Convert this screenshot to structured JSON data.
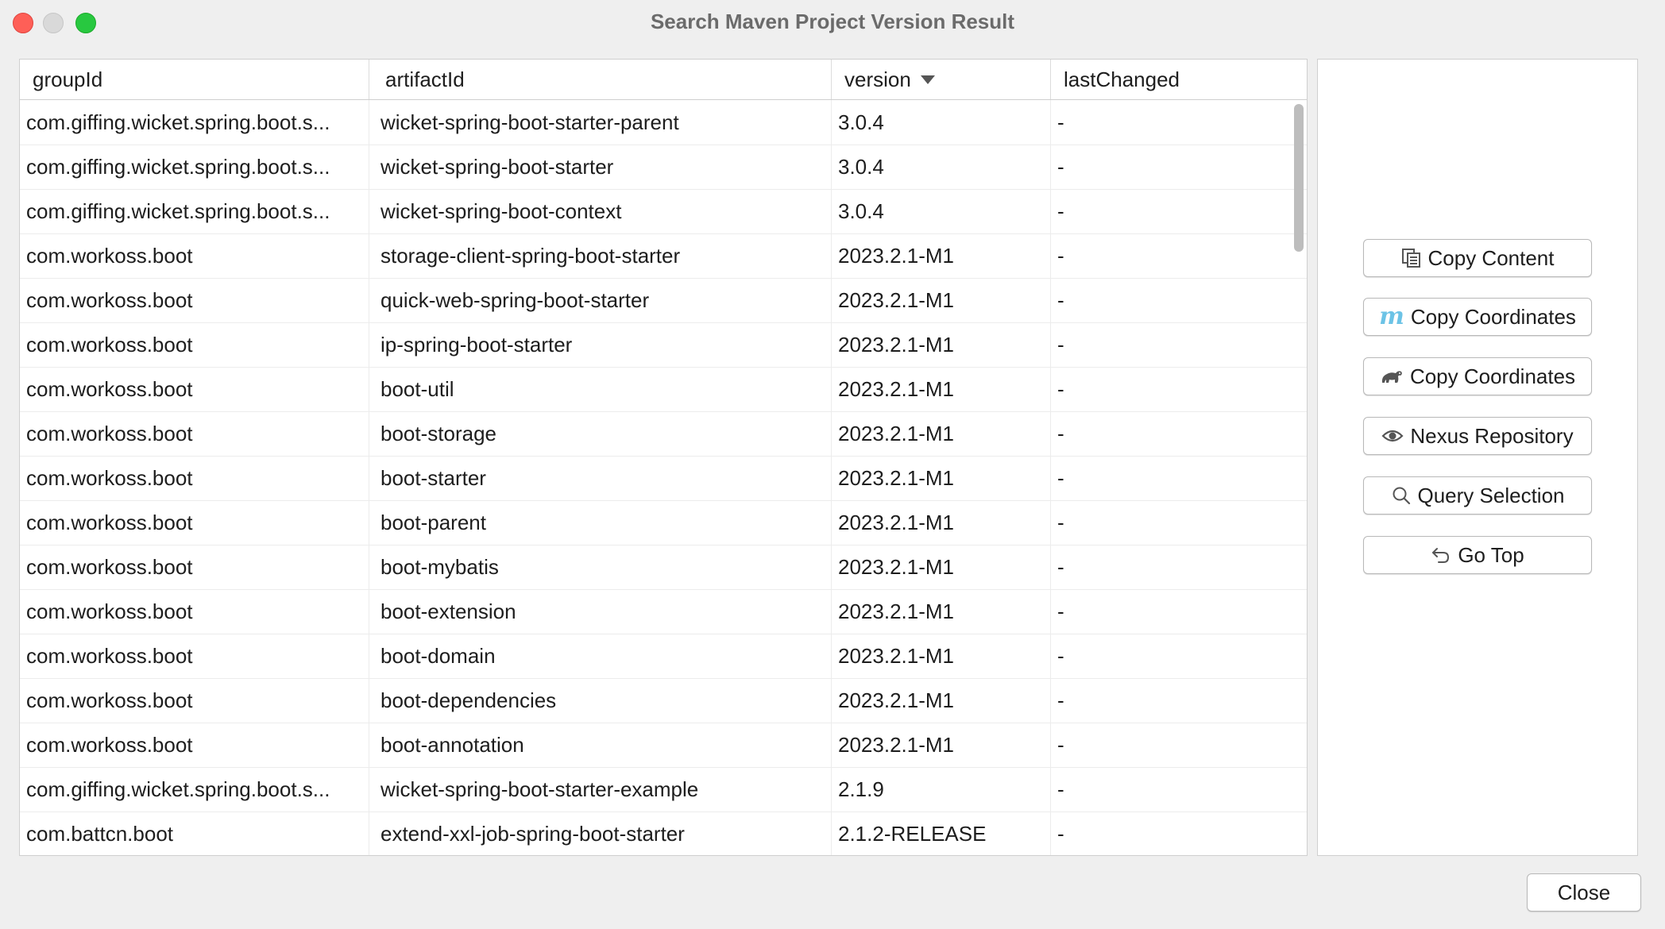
{
  "window": {
    "title": "Search Maven Project Version Result"
  },
  "table": {
    "columns": [
      "groupId",
      "artifactId",
      "version",
      "lastChanged"
    ],
    "rows": [
      [
        "com.giffing.wicket.spring.boot.s...",
        "wicket-spring-boot-starter-parent",
        "3.0.4",
        "-"
      ],
      [
        "com.giffing.wicket.spring.boot.s...",
        "wicket-spring-boot-starter",
        "3.0.4",
        "-"
      ],
      [
        "com.giffing.wicket.spring.boot.s...",
        "wicket-spring-boot-context",
        "3.0.4",
        "-"
      ],
      [
        "com.workoss.boot",
        "storage-client-spring-boot-starter",
        "2023.2.1-M1",
        "-"
      ],
      [
        "com.workoss.boot",
        "quick-web-spring-boot-starter",
        "2023.2.1-M1",
        "-"
      ],
      [
        "com.workoss.boot",
        "ip-spring-boot-starter",
        "2023.2.1-M1",
        "-"
      ],
      [
        "com.workoss.boot",
        "boot-util",
        "2023.2.1-M1",
        "-"
      ],
      [
        "com.workoss.boot",
        "boot-storage",
        "2023.2.1-M1",
        "-"
      ],
      [
        "com.workoss.boot",
        "boot-starter",
        "2023.2.1-M1",
        "-"
      ],
      [
        "com.workoss.boot",
        "boot-parent",
        "2023.2.1-M1",
        "-"
      ],
      [
        "com.workoss.boot",
        "boot-mybatis",
        "2023.2.1-M1",
        "-"
      ],
      [
        "com.workoss.boot",
        "boot-extension",
        "2023.2.1-M1",
        "-"
      ],
      [
        "com.workoss.boot",
        "boot-domain",
        "2023.2.1-M1",
        "-"
      ],
      [
        "com.workoss.boot",
        "boot-dependencies",
        "2023.2.1-M1",
        "-"
      ],
      [
        "com.workoss.boot",
        "boot-annotation",
        "2023.2.1-M1",
        "-"
      ],
      [
        "com.giffing.wicket.spring.boot.s...",
        "wicket-spring-boot-starter-example",
        "2.1.9",
        "-"
      ],
      [
        "com.battcn.boot",
        "extend-xxl-job-spring-boot-starter",
        "2.1.2-RELEASE",
        "-"
      ]
    ]
  },
  "actions": {
    "copy_content": {
      "label": "Copy Content",
      "icon": "copy-icon"
    },
    "copy_maven": {
      "label": "Copy Coordinates",
      "icon": "maven-icon"
    },
    "copy_gradle": {
      "label": "Copy Coordinates",
      "icon": "gradle-icon"
    },
    "nexus": {
      "label": "Nexus Repository",
      "icon": "eye-icon"
    },
    "query": {
      "label": "Query Selection",
      "icon": "search-icon"
    },
    "go_top": {
      "label": "Go Top",
      "icon": "undo-arrow-icon"
    }
  },
  "footer": {
    "close_label": "Close"
  },
  "maven_glyph": "m"
}
